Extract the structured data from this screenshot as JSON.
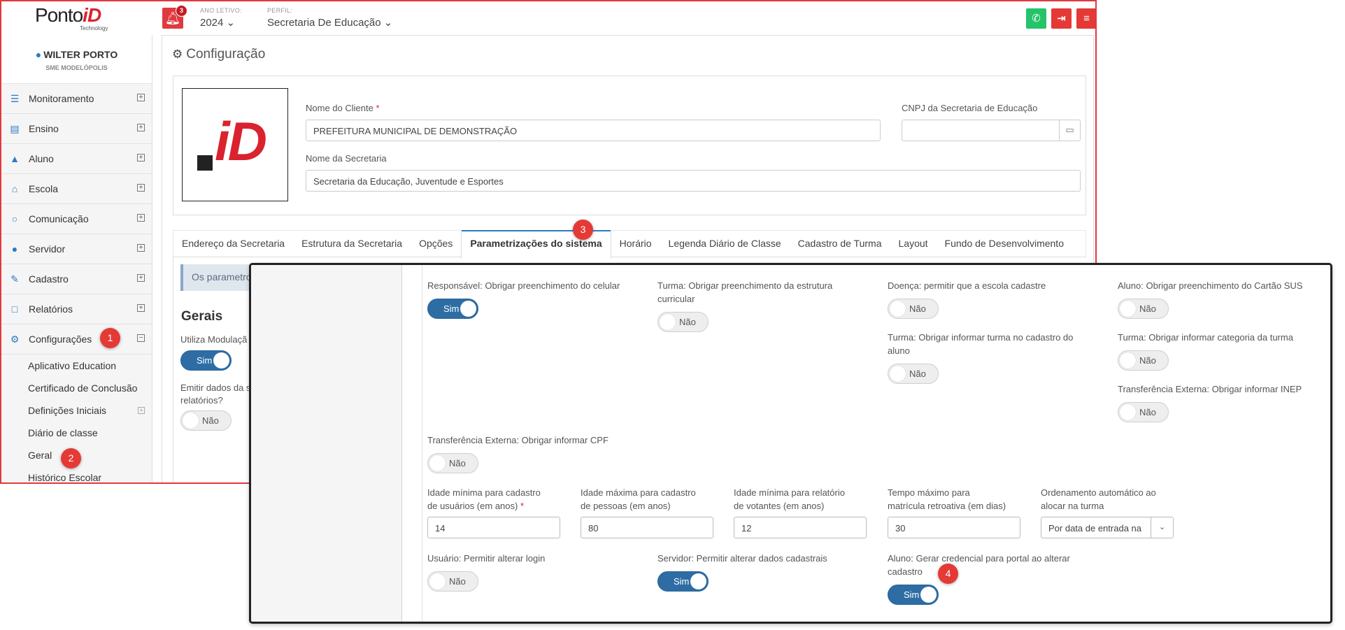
{
  "app": {
    "logo_text": "Ponto",
    "logo_accent": "iD",
    "logo_tagline": "Technology",
    "notification_count": "3",
    "year_label": "ANO LETIVO:",
    "year_value": "2024 ⌄",
    "profile_label": "PERFIL:",
    "profile_value": "Secretaria De Educação ⌄",
    "colors": {
      "accent": "#2b7cc2",
      "brand_red": "#d9232e",
      "whatsapp": "#25c36a",
      "logout": "#e53935",
      "menu": "#e53935",
      "toggle_on": "#2e6da4"
    }
  },
  "user": {
    "name": "WILTER PORTO",
    "org": "SME MODELÓPOLIS"
  },
  "sidebar": {
    "items": [
      {
        "label": "Monitoramento",
        "icon": "sliders-icon"
      },
      {
        "label": "Ensino",
        "icon": "book-icon"
      },
      {
        "label": "Aluno",
        "icon": "graduation-cap-icon"
      },
      {
        "label": "Escola",
        "icon": "bank-icon"
      },
      {
        "label": "Comunicação",
        "icon": "speech-bubble-icon"
      },
      {
        "label": "Servidor",
        "icon": "user-icon"
      },
      {
        "label": "Cadastro",
        "icon": "edit-icon"
      },
      {
        "label": "Relatórios",
        "icon": "file-icon"
      },
      {
        "label": "Configurações",
        "icon": "gear-icon"
      }
    ],
    "submenu": [
      "Aplicativo Education",
      "Certificado de Conclusão",
      "Definições Iniciais",
      "Diário de classe",
      "Geral",
      "Histórico Escolar"
    ]
  },
  "page": {
    "title": "Configuração",
    "client_name_label": "Nome do Cliente",
    "client_name_value": "PREFEITURA MUNICIPAL DE DEMONSTRAÇÃO",
    "cnpj_label": "CNPJ da Secretaria de Educação",
    "cnpj_value": "",
    "secretaria_label": "Nome da Secretaria",
    "secretaria_value": "Secretaria da Educação, Juventude e Esportes",
    "tabs": [
      "Endereço da Secretaria",
      "Estrutura da Secretaria",
      "Opções",
      "Parametrizações do sistema",
      "Horário",
      "Legenda Diário de Classe",
      "Cadastro de Turma",
      "Layout",
      "Fundo de Desenvolvimento"
    ],
    "alert_text": "Os parametros",
    "section_title": "Gerais",
    "modulacao_label": "Utiliza Modulaçã",
    "modulacao_value": "Sim",
    "emitir_label_1": "Emitir dados da s",
    "emitir_label_2": "relatórios?",
    "emitir_value": "Não"
  },
  "markers": [
    "1",
    "2",
    "3",
    "4"
  ],
  "overlay": {
    "toggles": [
      {
        "label": "Responsável: Obrigar preenchimento do celular",
        "value": "Sim",
        "on": true
      },
      {
        "label": "Turma: Obrigar preenchimento da estrutura curricular",
        "value": "Não",
        "on": false
      },
      {
        "label": "Doença: permitir que a escola cadastre",
        "value": "Não",
        "on": false
      },
      {
        "label": "Aluno: Obrigar preenchimento do Cartão SUS",
        "value": "Não",
        "on": false
      },
      {
        "label": "Turma: Obrigar informar turma no cadastro do aluno",
        "value": "Não",
        "on": false
      },
      {
        "label": "Turma: Obrigar informar categoria da turma",
        "value": "Não",
        "on": false
      },
      {
        "label": "Transferência Externa: Obrigar informar INEP",
        "value": "Não",
        "on": false
      },
      {
        "label": "Transferência Externa: Obrigar informar CPF",
        "value": "Não",
        "on": false
      },
      {
        "label": "Usuário: Permitir alterar login",
        "value": "Não",
        "on": false
      },
      {
        "label": "Servidor: Permitir alterar dados cadastrais",
        "value": "Sim",
        "on": true
      },
      {
        "label": "Aluno: Gerar credencial para portal ao alterar cadastro",
        "value": "Sim",
        "on": true
      }
    ],
    "fields": [
      {
        "label_1": "Idade mínima para cadastro",
        "label_2": "de usuários (em anos)",
        "required": true,
        "value": "14"
      },
      {
        "label_1": "Idade máxima para cadastro",
        "label_2": "de pessoas (em anos)",
        "required": false,
        "value": "80"
      },
      {
        "label_1": "Idade mínima para relatório",
        "label_2": "de votantes (em anos)",
        "required": false,
        "value": "12"
      },
      {
        "label_1": "Tempo máximo para",
        "label_2": "matrícula retroativa (em dias)",
        "required": false,
        "value": "30"
      },
      {
        "label_1": "Ordenamento automático ao",
        "label_2": "alocar na turma",
        "required": false,
        "value": "Por data de entrada na"
      }
    ]
  }
}
